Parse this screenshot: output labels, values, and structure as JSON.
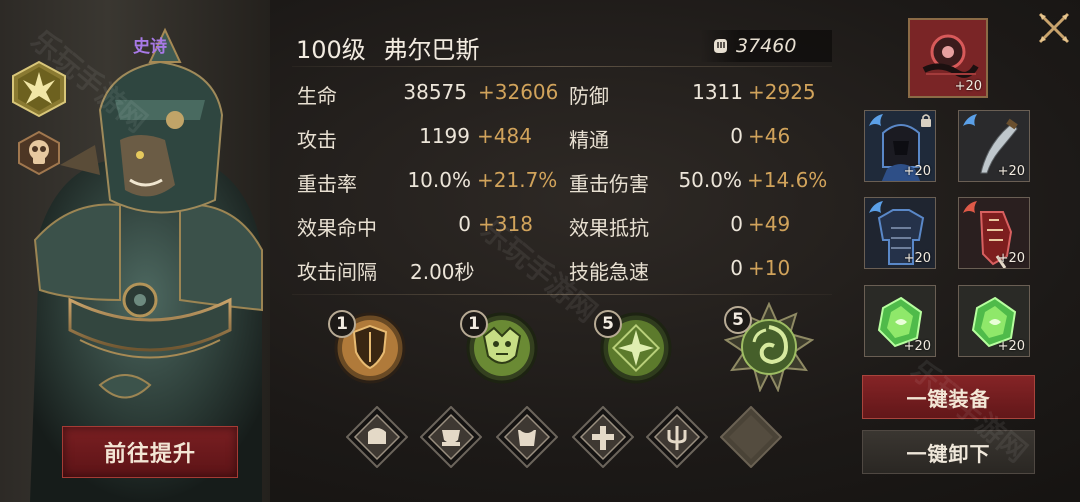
{
  "hero": {
    "rarity": "史诗",
    "upgrade_button": "前往提升",
    "class_icon": "winged-crest-icon",
    "role_icon": "skull-icon"
  },
  "character": {
    "level": "100级",
    "name": "弗尔巴斯",
    "power": "37460",
    "power_icon": "power-fist-icon"
  },
  "stats": [
    {
      "label": "生命",
      "base": "38575",
      "bonus": "+32606"
    },
    {
      "label": "防御",
      "base": "1311",
      "bonus": "+2925"
    },
    {
      "label": "攻击",
      "base": "1199",
      "bonus": "+484"
    },
    {
      "label": "精通",
      "base": "0",
      "bonus": "+46"
    },
    {
      "label": "重击率",
      "base": "10.0%",
      "bonus": "+21.7%"
    },
    {
      "label": "重击伤害",
      "base": "50.0%",
      "bonus": "+14.6%"
    },
    {
      "label": "效果命中",
      "base": "0",
      "bonus": "+318"
    },
    {
      "label": "效果抵抗",
      "base": "0",
      "bonus": "+49"
    },
    {
      "label": "攻击间隔",
      "base": "2.00秒",
      "bonus": ""
    },
    {
      "label": "技能急速",
      "base": "0",
      "bonus": "+10"
    }
  ],
  "skills": [
    {
      "level": "1",
      "icon": "shield-skill-icon"
    },
    {
      "level": "1",
      "icon": "demon-mask-skill-icon"
    },
    {
      "level": "5",
      "icon": "star-sigil-skill-icon"
    },
    {
      "level": "5",
      "icon": "swirl-passive-skill-icon"
    }
  ],
  "runes": [
    {
      "icon": "helmet-rune-icon"
    },
    {
      "icon": "chest-rune-icon"
    },
    {
      "icon": "armor-rune-icon"
    },
    {
      "icon": "cross-rune-icon"
    },
    {
      "icon": "trident-rune-icon"
    },
    {
      "icon": "empty-rune-slot"
    }
  ],
  "equipment": {
    "featured": {
      "plus": "+20"
    },
    "slots": [
      {
        "name": "helmet",
        "plus": "+20",
        "locked": true
      },
      {
        "name": "weapon",
        "plus": "+20",
        "locked": false
      },
      {
        "name": "armor",
        "plus": "+20",
        "locked": false
      },
      {
        "name": "gauntlet",
        "plus": "+20",
        "locked": false
      },
      {
        "name": "gem-left",
        "plus": "+20",
        "locked": false
      },
      {
        "name": "gem-right",
        "plus": "+20",
        "locked": false
      }
    ],
    "equip_all": "一键装备",
    "unequip_all": "一键卸下"
  },
  "watermark": "乐玩手游网",
  "colors": {
    "bonus": "#d1a35b",
    "rarity_epic": "#a779e6",
    "primary_button": "#852426"
  }
}
